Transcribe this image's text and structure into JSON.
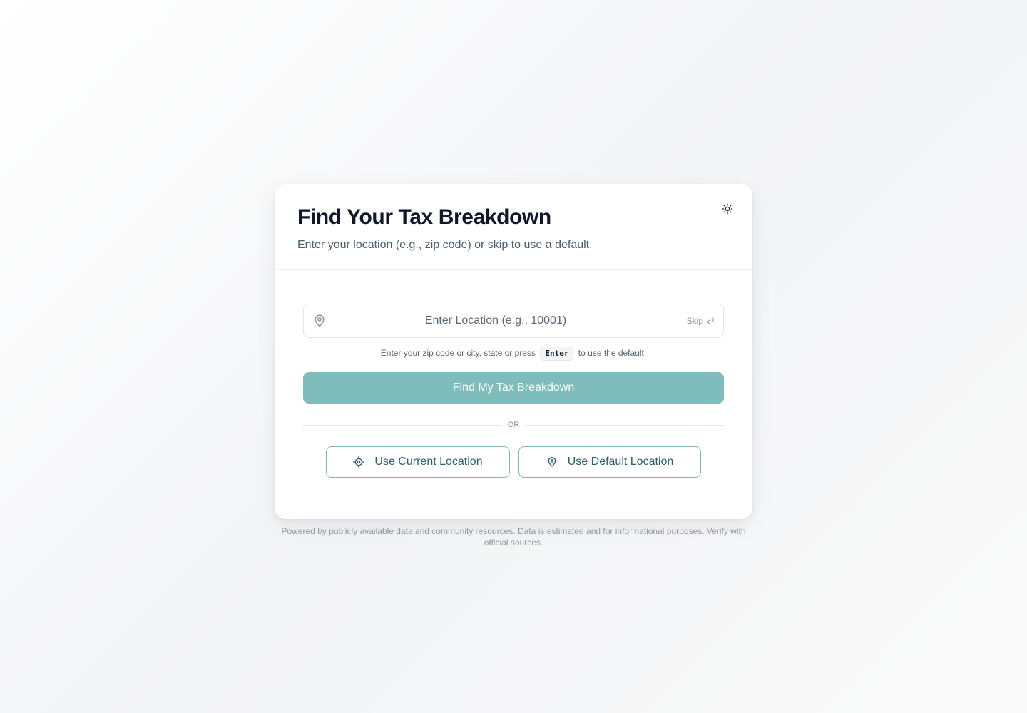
{
  "header": {
    "title": "Find Your Tax Breakdown",
    "subtitle": "Enter your location (e.g., zip code) or skip to use a default.",
    "theme_toggle_icon": "sun-icon"
  },
  "location_input": {
    "placeholder": "Enter Location (e.g., 10001)",
    "value": "",
    "skip_label": "Skip",
    "icon": "map-pin-icon"
  },
  "hint": {
    "before": "Enter your zip code or city, state or press",
    "key": "Enter",
    "after": "to use the default."
  },
  "primary_button": {
    "label": "Find My Tax Breakdown",
    "color": "#7fbdbd"
  },
  "divider_label": "OR",
  "alt_buttons": {
    "current_location": {
      "label": "Use Current Location",
      "icon": "crosshair-icon"
    },
    "default_location": {
      "label": "Use Default Location",
      "icon": "map-pin-icon"
    }
  },
  "footer": {
    "text": "Powered by publicly available data and community resources. Data is estimated and for informational purposes. Verify with official sources."
  },
  "colors": {
    "accent": "#7fbdbd",
    "accent_text": "#2d5f66",
    "title": "#0f172a"
  }
}
